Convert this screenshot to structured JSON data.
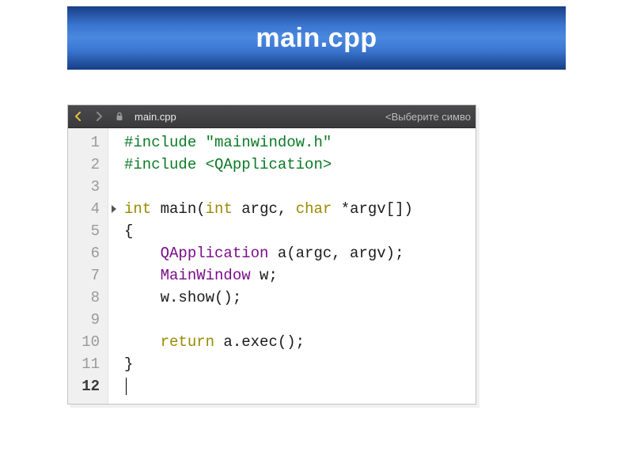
{
  "header": {
    "title": "main.cpp"
  },
  "toolbar": {
    "filename": "main.cpp",
    "symbol_picker": "Выберите симво"
  },
  "icons": {
    "nav_back": "◄",
    "nav_fwd": "►",
    "lock": "🔒"
  },
  "code": {
    "lines": [
      {
        "n": "1",
        "tokens": [
          [
            "pre",
            "#include "
          ],
          [
            "str",
            "\"mainwindow.h\""
          ]
        ]
      },
      {
        "n": "2",
        "tokens": [
          [
            "pre",
            "#include "
          ],
          [
            "str",
            "<QApplication>"
          ]
        ]
      },
      {
        "n": "3",
        "tokens": []
      },
      {
        "n": "4",
        "mark": true,
        "tokens": [
          [
            "kw",
            "int"
          ],
          [
            "plain",
            " "
          ],
          [
            "plain",
            "main"
          ],
          [
            "plain",
            "("
          ],
          [
            "kw",
            "int"
          ],
          [
            "plain",
            " argc, "
          ],
          [
            "kw",
            "char"
          ],
          [
            "plain",
            " *argv[])"
          ]
        ]
      },
      {
        "n": "5",
        "tokens": [
          [
            "plain",
            "{"
          ]
        ]
      },
      {
        "n": "6",
        "tokens": [
          [
            "plain",
            "    "
          ],
          [
            "type",
            "QApplication"
          ],
          [
            "plain",
            " a(argc, argv);"
          ]
        ]
      },
      {
        "n": "7",
        "tokens": [
          [
            "plain",
            "    "
          ],
          [
            "type",
            "MainWindow"
          ],
          [
            "plain",
            " w;"
          ]
        ]
      },
      {
        "n": "8",
        "tokens": [
          [
            "plain",
            "    w.show();"
          ]
        ]
      },
      {
        "n": "9",
        "tokens": []
      },
      {
        "n": "10",
        "tokens": [
          [
            "plain",
            "    "
          ],
          [
            "kw",
            "return"
          ],
          [
            "plain",
            " a.exec();"
          ]
        ]
      },
      {
        "n": "11",
        "tokens": [
          [
            "plain",
            "}"
          ]
        ]
      },
      {
        "n": "12",
        "current": true,
        "caret": true,
        "tokens": []
      }
    ]
  }
}
